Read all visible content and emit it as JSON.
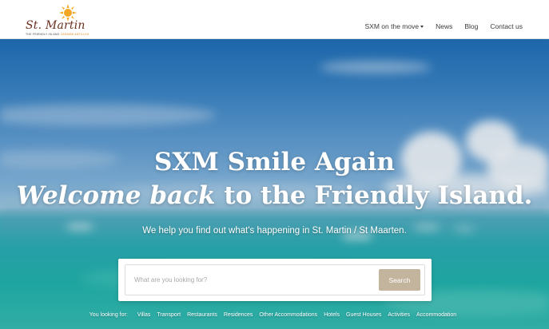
{
  "brand": {
    "name": "St. Martin",
    "tagline_prefix": "THE FRIENDLY ISLAND",
    "tagline_accent": "CARAÏBE ANTILLES"
  },
  "nav": {
    "items": [
      {
        "label": "SXM on the move",
        "has_dropdown": true
      },
      {
        "label": "News"
      },
      {
        "label": "Blog"
      },
      {
        "label": "Contact us"
      }
    ]
  },
  "hero": {
    "headline_line1": "SXM Smile Again",
    "headline_line2_emphasis": "Welcome back",
    "headline_line2_rest": " to the Friendly Island.",
    "subheadline": "We help you find out what's happening in St. Martin / St Maarten."
  },
  "search": {
    "placeholder": "What are you looking for?",
    "value": "",
    "button_label": "Search"
  },
  "quick_links": {
    "label": "You looking for:",
    "items": [
      "Villas",
      "Transport",
      "Restaurants",
      "Residences",
      "Other Accommodations",
      "Hotels",
      "Guest Houses",
      "Activities",
      "Accommodation"
    ]
  },
  "colors": {
    "accent": "#c3b49e",
    "brand_text": "#6b2f1f",
    "sun": "#f5a623"
  }
}
